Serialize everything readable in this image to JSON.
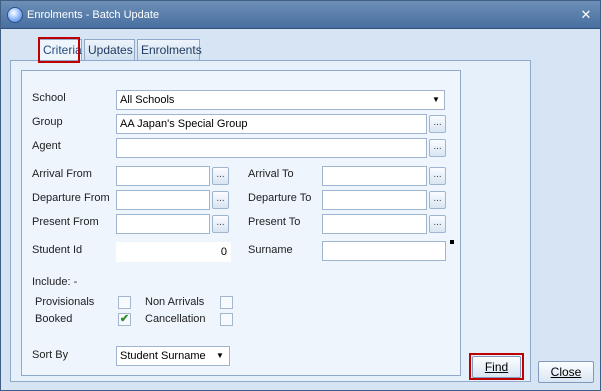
{
  "window": {
    "title": "Enrolments - Batch Update",
    "close_glyph": "✕"
  },
  "tabs": [
    {
      "label": "Criteria",
      "active": true
    },
    {
      "label": "Updates",
      "active": false
    },
    {
      "label": "Enrolments",
      "active": false
    }
  ],
  "form": {
    "school": {
      "label": "School",
      "value": "All Schools"
    },
    "group": {
      "label": "Group",
      "value": "AA Japan's Special Group"
    },
    "agent": {
      "label": "Agent",
      "value": ""
    },
    "arrival_from": {
      "label": "Arrival From",
      "value": ""
    },
    "arrival_to": {
      "label": "Arrival To",
      "value": ""
    },
    "departure_from": {
      "label": "Departure From",
      "value": ""
    },
    "departure_to": {
      "label": "Departure To",
      "value": ""
    },
    "present_from": {
      "label": "Present From",
      "value": ""
    },
    "present_to": {
      "label": "Present To",
      "value": ""
    },
    "student_id": {
      "label": "Student Id",
      "value": "0"
    },
    "surname": {
      "label": "Surname",
      "value": ""
    },
    "include_label": "Include: -",
    "include": [
      {
        "label": "Provisionals",
        "checked": false
      },
      {
        "label": "Non Arrivals",
        "checked": false
      },
      {
        "label": "Booked",
        "checked": true
      },
      {
        "label": "Cancellation",
        "checked": false
      }
    ],
    "sort_by": {
      "label": "Sort By",
      "value": "Student Surname"
    },
    "lookup_glyph": "...",
    "check_glyph": "✔",
    "caret_glyph": "▼"
  },
  "buttons": {
    "find": "Find",
    "close": "Close"
  },
  "colors": {
    "highlight": "#c00000",
    "titlebar": "#5a7eab",
    "panel": "#e6f0fb"
  }
}
